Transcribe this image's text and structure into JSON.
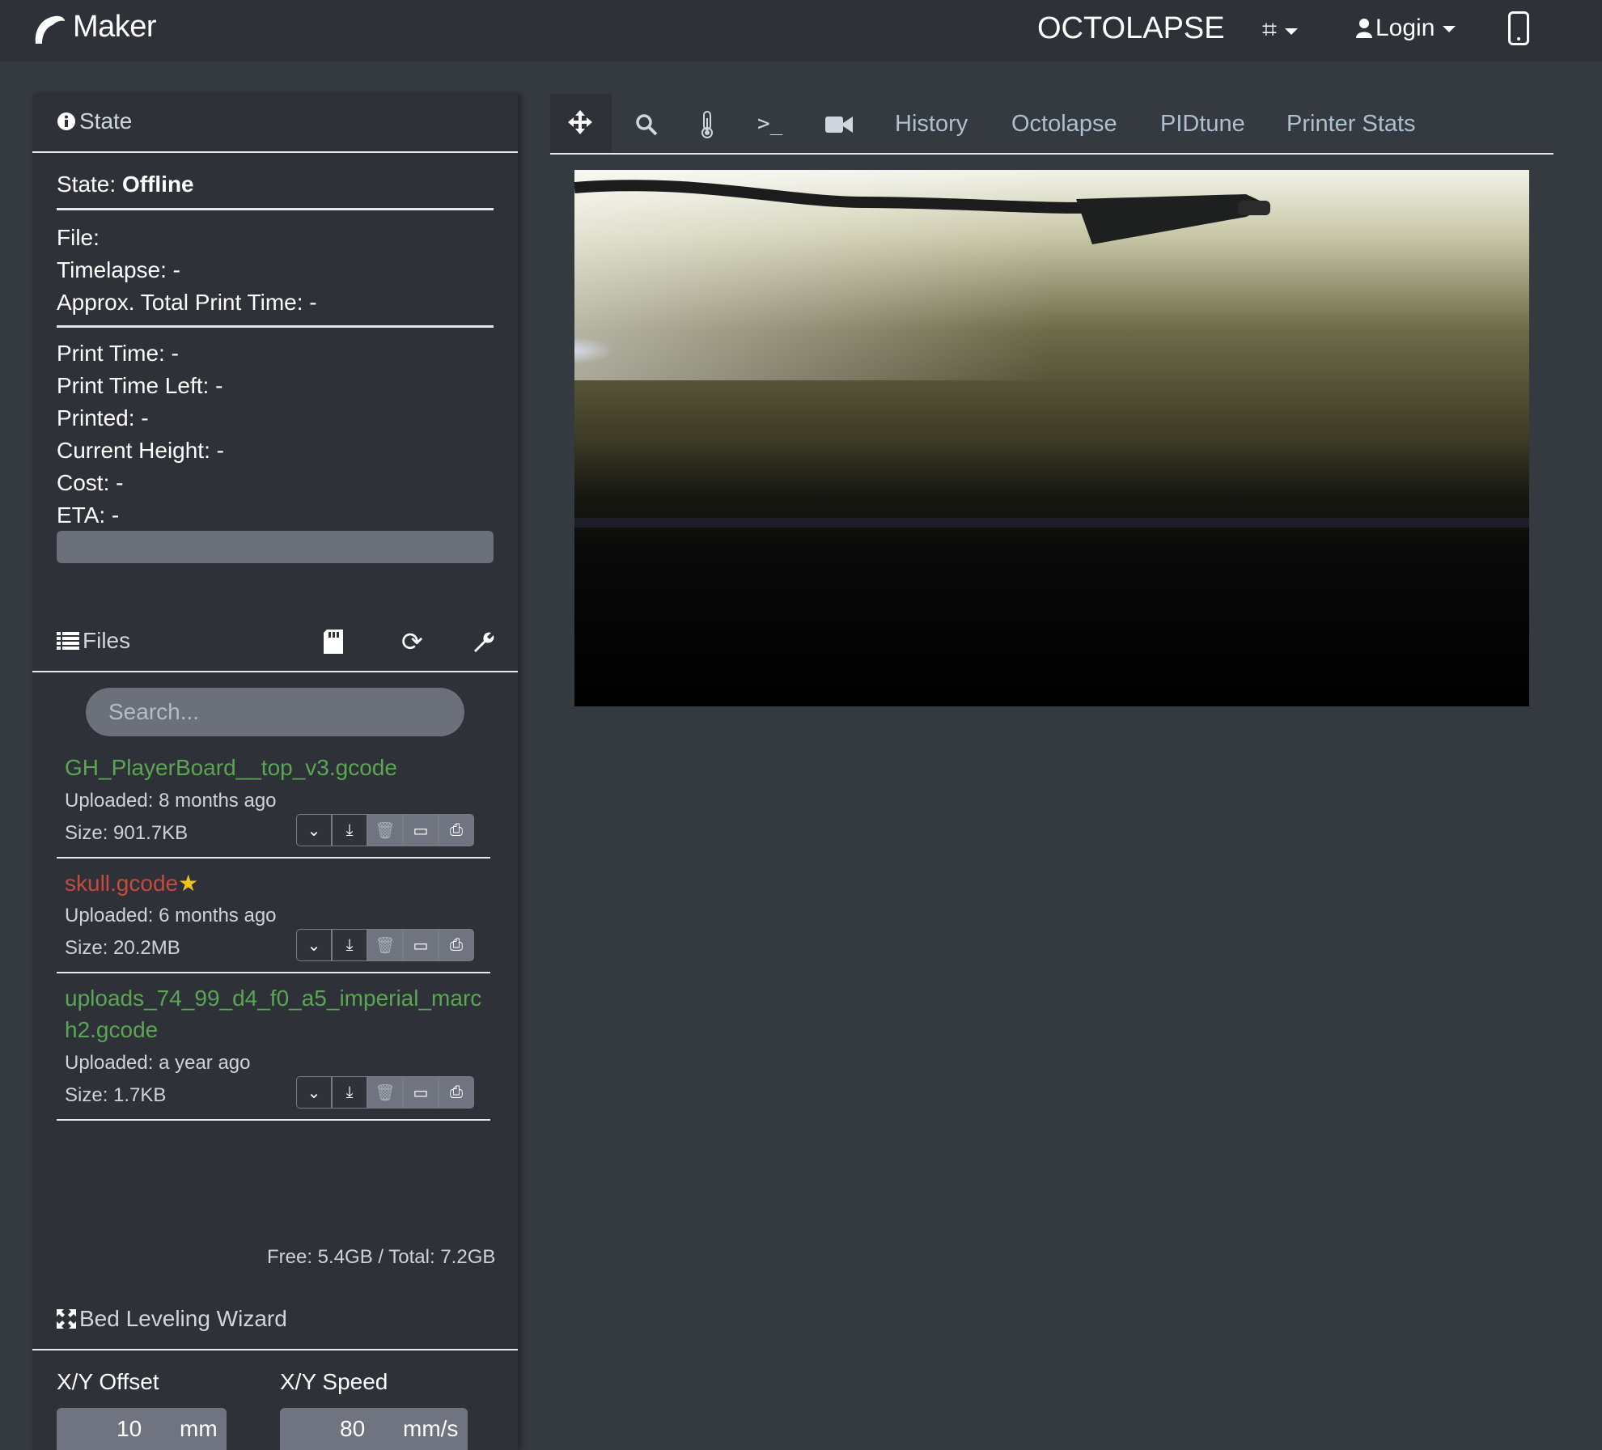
{
  "navbar": {
    "brand": "Maker",
    "octolapse": "OCTOLAPSE",
    "login": "Login"
  },
  "state": {
    "title": "State",
    "state_label": "State:",
    "state_value": "Offline",
    "file": "File:",
    "timelapse": "Timelapse: -",
    "approx_total": "Approx. Total Print Time: -",
    "print_time": "Print Time: -",
    "print_time_left": "Print Time Left: -",
    "printed": "Printed: -",
    "current_height": "Current Height: -",
    "cost": "Cost: -",
    "eta": "ETA: -",
    "progress": 0
  },
  "files": {
    "title": "Files",
    "search_placeholder": "Search...",
    "items": [
      {
        "name": "GH_PlayerBoard__top_v3.gcode",
        "uploaded": "Uploaded: 8 months ago",
        "size": "Size: 901.7KB",
        "color": "#5aa652"
      },
      {
        "name": "skull.gcode",
        "star": "★",
        "uploaded": "Uploaded: 6 months ago",
        "size": "Size: 20.2MB",
        "color": "#c64a3e"
      },
      {
        "name_line1": "uploads_74_99_d4_f0_a5_imperial_marc",
        "name_line2": "h2.gcode",
        "uploaded": "Uploaded: a year ago",
        "size": "Size: 1.7KB",
        "color": "#5aa652"
      }
    ],
    "free": "Free: 5.4GB / Total: 7.2GB"
  },
  "bed_leveling": {
    "title": "Bed Leveling Wizard",
    "xy_offset_label": "X/Y Offset",
    "xy_offset_value": "10",
    "xy_offset_unit": "mm",
    "xy_speed_label": "X/Y Speed",
    "xy_speed_value": "80",
    "xy_speed_unit": "mm/s"
  },
  "tabs": {
    "history": "History",
    "octolapse": "Octolapse",
    "pidtune": "PIDtune",
    "printer_stats": "Printer Stats"
  },
  "icons": {
    "brand": "octoprint-logo-icon",
    "crop": "crop-icon",
    "user": "user-icon",
    "phone": "mobile-icon",
    "info": "info-icon",
    "list": "list-icon",
    "sd": "sd-card-icon",
    "refresh": "refresh-icon",
    "wrench": "wrench-icon",
    "move": "move-icon",
    "search": "search-icon",
    "thermometer": "thermometer-icon",
    "terminal": "terminal-icon",
    "camera": "video-camera-icon"
  },
  "colors": {
    "background": "#353940",
    "panel": "#2e3138",
    "file_ok": "#5aa652",
    "file_recent": "#c64a3e",
    "star": "#f0c419"
  }
}
